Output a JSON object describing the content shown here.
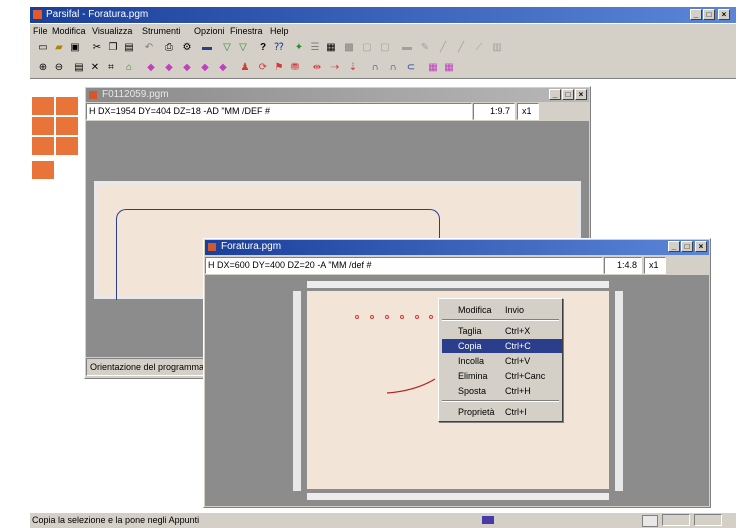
{
  "app": {
    "title": "Parsifal - Foratura.pgm",
    "controls": {
      "minimize": "_",
      "maximize": "□",
      "close": "×"
    }
  },
  "menu": [
    "File",
    "Modifica",
    "Visualizza",
    "Strumenti",
    "Opzioni",
    "Finestra",
    "Help"
  ],
  "win1": {
    "title": "F0112059.pgm",
    "header": "H DX=1954 DY=404 DZ=18 -AD \"MM /DEF #",
    "zoom": "1:9.7",
    "mult": "x1",
    "status": "Orientazione del programma"
  },
  "win2": {
    "title": "Foratura.pgm",
    "header": "H DX=600 DY=400 DZ=20 -A \"MM /def #",
    "zoom": "1:4.8",
    "mult": "x1"
  },
  "context_menu": {
    "items": [
      {
        "label": "Modifica",
        "key": "Invio"
      },
      {
        "label": "Taglia",
        "key": "Ctrl+X"
      },
      {
        "label": "Copia",
        "key": "Ctrl+C",
        "selected": true
      },
      {
        "label": "Incolla",
        "key": "Ctrl+V"
      },
      {
        "label": "Elimina",
        "key": "Ctrl+Canc"
      },
      {
        "label": "Sposta",
        "key": "Ctrl+H"
      },
      {
        "label": "Proprietà",
        "key": "Ctrl+I"
      }
    ]
  },
  "statusbar": {
    "text": "Copia la selezione e la pone negli Appunti"
  },
  "colors": {
    "accent": "#2a3e8c",
    "workpiece": "#f3e4d8",
    "canvas": "#8c8c8c"
  }
}
